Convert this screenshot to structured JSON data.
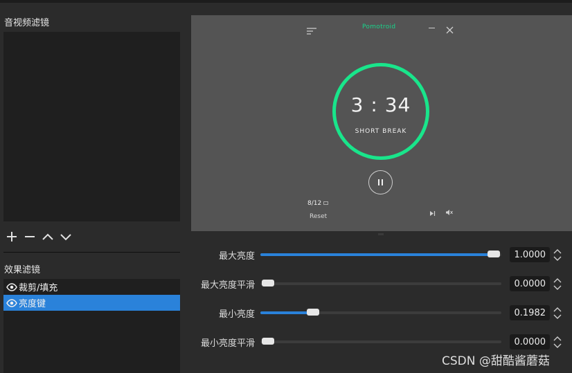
{
  "audio_video_filters": {
    "title": "音视频滤镜"
  },
  "toolbar": {
    "add_icon": "plus-icon",
    "remove_icon": "minus-icon",
    "up_icon": "chevron-up-icon",
    "down_icon": "chevron-down-icon"
  },
  "effect_filters": {
    "title": "效果滤镜",
    "items": [
      {
        "label": "裁剪/填充",
        "selected": false
      },
      {
        "label": "亮度键",
        "selected": true
      }
    ]
  },
  "preview": {
    "app_name": "Pomotroid",
    "time": "3 : 34",
    "mode": "SHORT BREAK",
    "round": "8/12",
    "reset_label": "Reset",
    "accent_color": "#19e58b"
  },
  "properties": [
    {
      "label": "最大亮度",
      "value": "1.0000",
      "level": 1.0
    },
    {
      "label": "最大亮度平滑",
      "value": "0.0000",
      "level": 0.0
    },
    {
      "label": "最小亮度",
      "value": "0.1982",
      "level": 0.1982
    },
    {
      "label": "最小亮度平滑",
      "value": "0.0000",
      "level": 0.0
    }
  ],
  "watermark": "CSDN @甜酷酱蘑菇",
  "colors": {
    "selection": "#2a82da",
    "panel_bg": "#2b2b2b",
    "list_bg": "#1f1f1f"
  }
}
